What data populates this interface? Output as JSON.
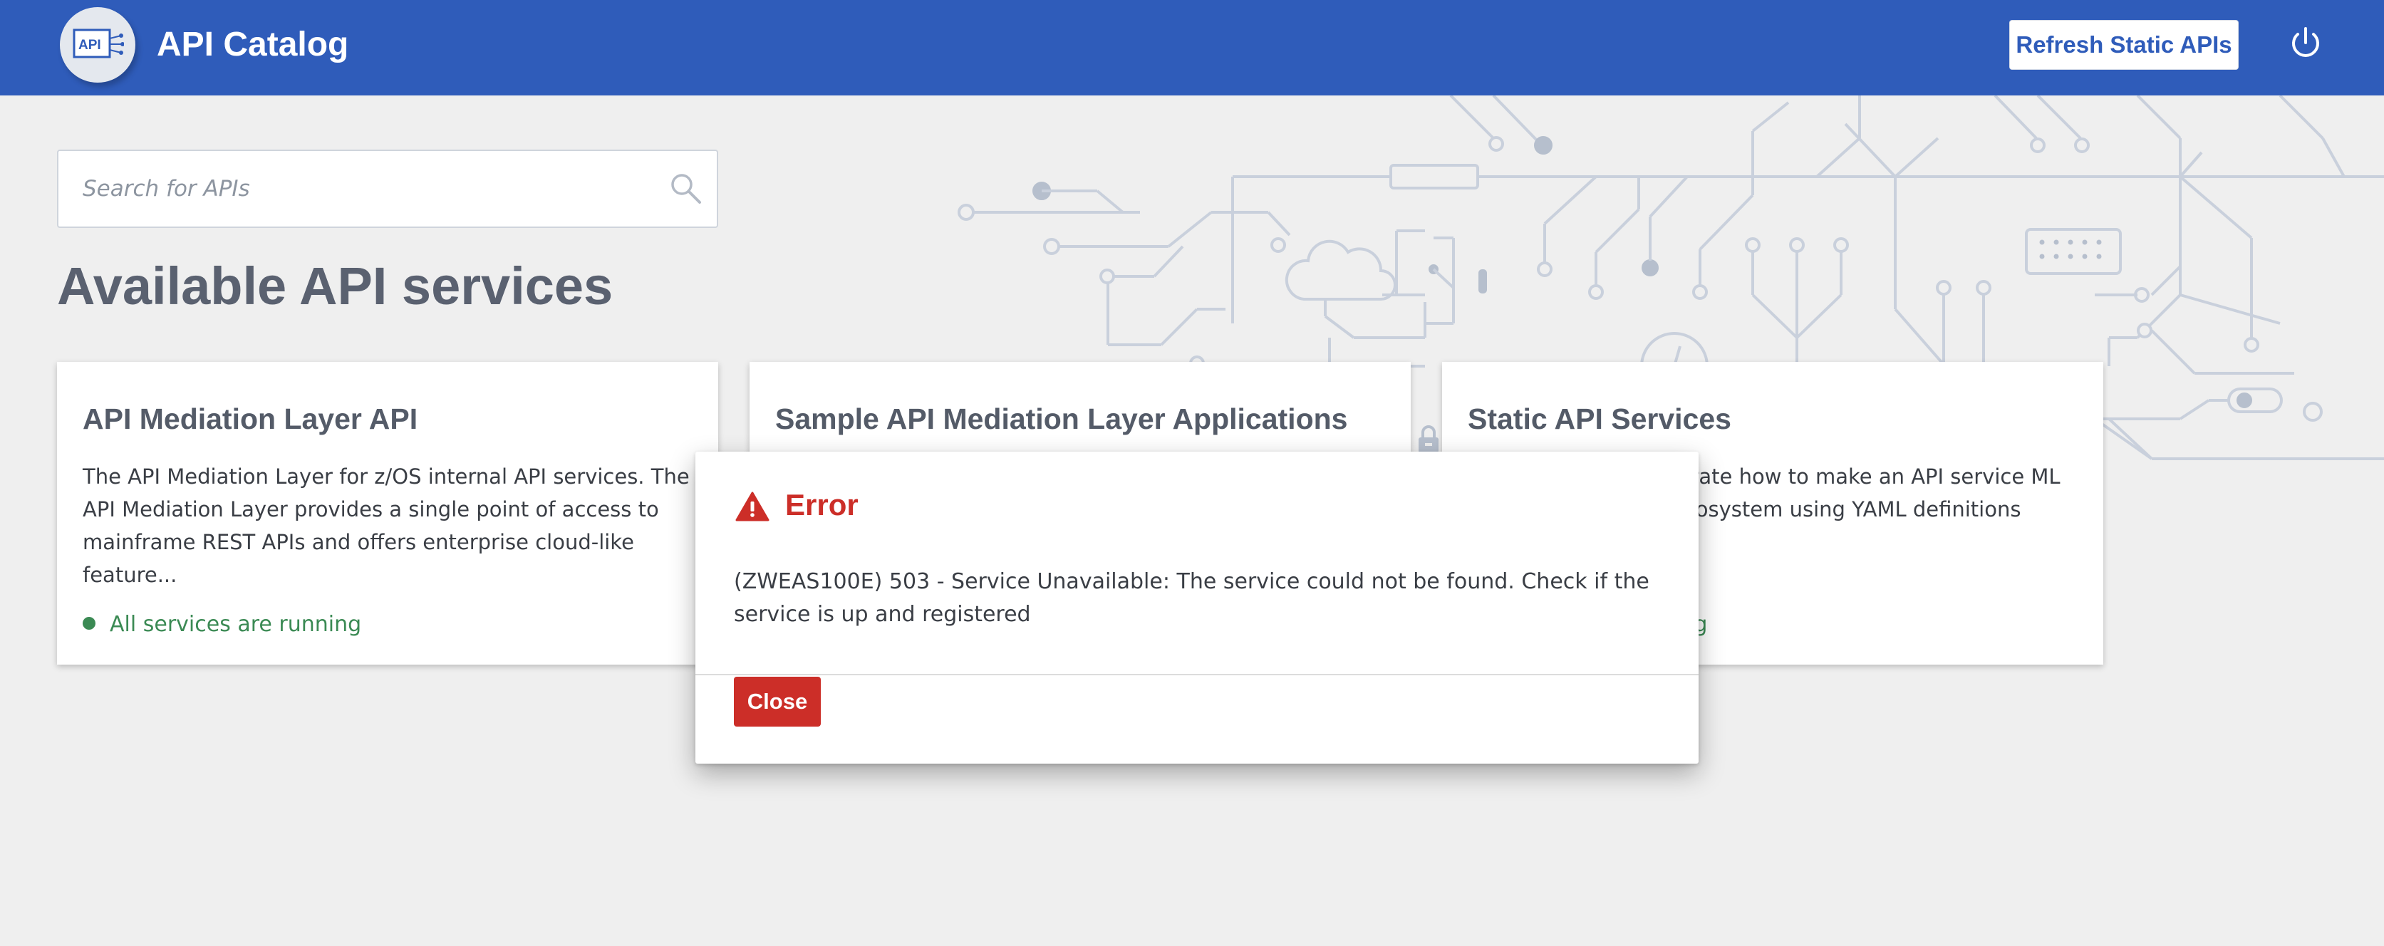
{
  "header": {
    "title": "API Catalog",
    "logo_text": "API",
    "refresh_label": "Refresh Static APIs",
    "power_icon": "power-icon"
  },
  "search": {
    "placeholder": "Search for APIs",
    "value": ""
  },
  "main": {
    "title": "Available API services",
    "cards": [
      {
        "title": "API Mediation Layer API",
        "description": "The API Mediation Layer for z/OS internal API services. The API Mediation Layer provides a single point of access to mainframe REST APIs and offers enterprise cloud-like feature...",
        "status": "All services are running"
      },
      {
        "title": "Sample API Mediation Layer Applications",
        "description": "",
        "status": ""
      },
      {
        "title": "Static API Services",
        "description": "strate how to make an API service ML ecosystem using YAML definitions",
        "status": "ing"
      }
    ]
  },
  "dialog": {
    "title": "Error",
    "message": "(ZWEAS100E) 503 - Service Unavailable: The service could not be found. Check if the service is up and registered",
    "close_label": "Close"
  },
  "colors": {
    "header": "#2f5cba",
    "background": "#efefef",
    "error": "#cc2e28",
    "status_ok": "#3b8a54",
    "title_text": "#5a6170"
  }
}
